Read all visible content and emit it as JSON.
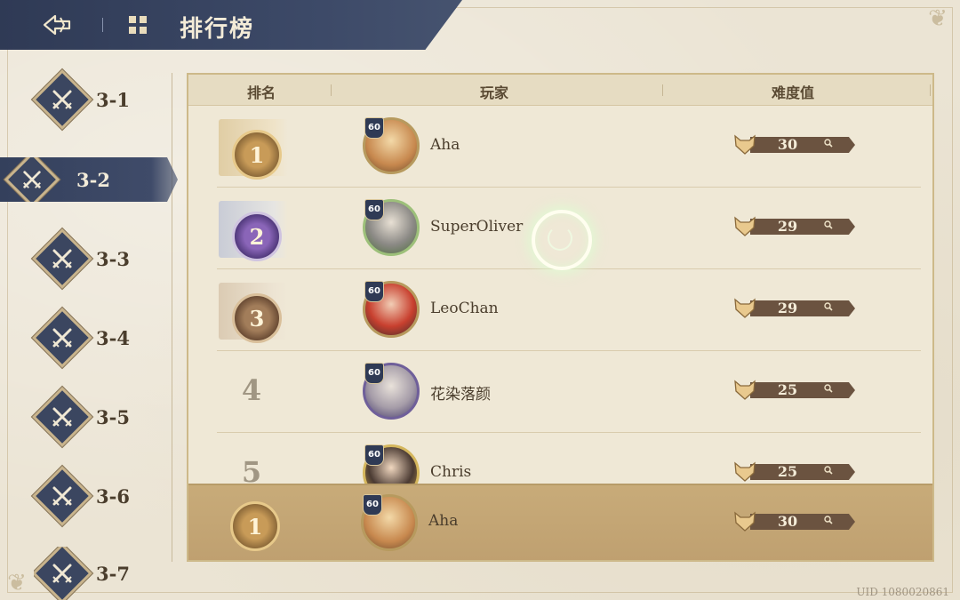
{
  "header": {
    "title": "排行榜"
  },
  "sidebar": {
    "items": [
      {
        "label": "3-1",
        "active": false
      },
      {
        "label": "3-2",
        "active": true
      },
      {
        "label": "3-3",
        "active": false
      },
      {
        "label": "3-4",
        "active": false
      },
      {
        "label": "3-5",
        "active": false
      },
      {
        "label": "3-6",
        "active": false
      },
      {
        "label": "3-7",
        "active": false
      }
    ]
  },
  "table": {
    "columns": {
      "rank": "排名",
      "player": "玩家",
      "difficulty": "难度值"
    },
    "rows": [
      {
        "rank": "1",
        "name": "Aha",
        "level": "60",
        "difficulty": "30",
        "medal": "gold"
      },
      {
        "rank": "2",
        "name": "SuperOliver",
        "level": "60",
        "difficulty": "29",
        "medal": "purple"
      },
      {
        "rank": "3",
        "name": "LeoChan",
        "level": "60",
        "difficulty": "29",
        "medal": "bronze"
      },
      {
        "rank": "4",
        "name": "花染落颜",
        "level": "60",
        "difficulty": "25",
        "medal": "none"
      },
      {
        "rank": "5",
        "name": "Chris",
        "level": "60",
        "difficulty": "25",
        "medal": "none"
      }
    ]
  },
  "self": {
    "rank": "1",
    "name": "Aha",
    "level": "60",
    "difficulty": "30"
  },
  "footer": {
    "uid": "UID 1080020861"
  },
  "colors": {
    "navy": "#2f3a55",
    "gold": "#c9b48c",
    "parchment": "#ece5d6",
    "self_row": "#c4a675",
    "difficulty_bar": "#6b5340"
  },
  "icons": [
    "back-arrow-icon",
    "leaderboard-grid-icon",
    "crossed-swords-icon",
    "rank-medal-icon",
    "level-shield-icon",
    "fox-difficulty-icon",
    "magnifier-icon",
    "loading-ring-icon"
  ]
}
